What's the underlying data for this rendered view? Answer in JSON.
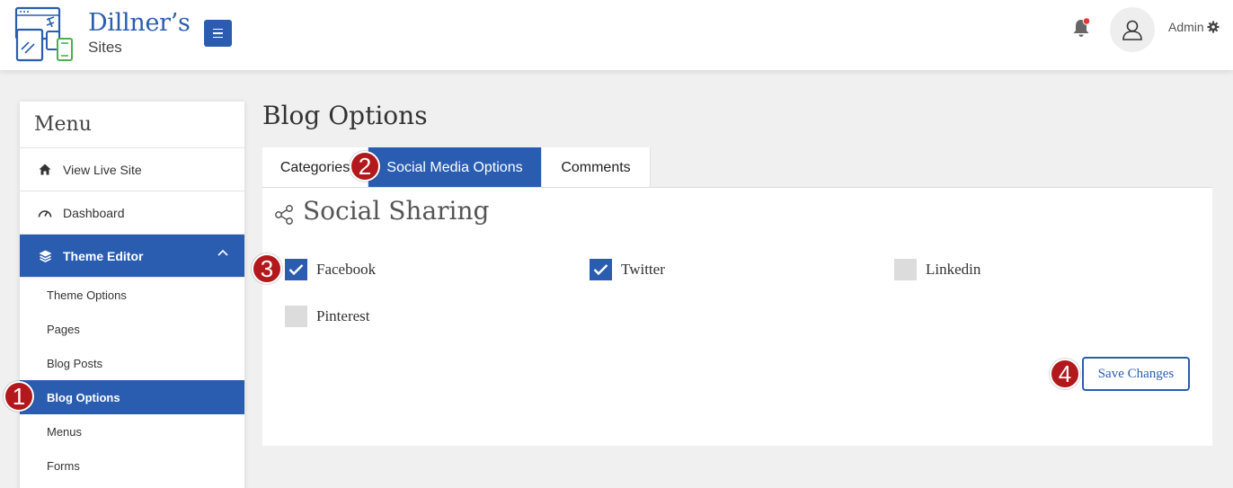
{
  "header": {
    "logo_title": "Dillner’s",
    "logo_subtitle": "Sites",
    "user_label": "Admin"
  },
  "sidebar": {
    "title": "Menu",
    "items": [
      {
        "label": "View Live Site",
        "icon": "home-icon"
      },
      {
        "label": "Dashboard",
        "icon": "dashboard-icon"
      },
      {
        "label": "Theme Editor",
        "icon": "layers-icon",
        "expanded": true
      }
    ],
    "subitems": [
      {
        "label": "Theme Options"
      },
      {
        "label": "Pages"
      },
      {
        "label": "Blog Posts"
      },
      {
        "label": "Blog Options",
        "active": true
      },
      {
        "label": "Menus"
      },
      {
        "label": "Forms"
      }
    ]
  },
  "main": {
    "page_title": "Blog Options",
    "tabs": [
      {
        "label": "Categories"
      },
      {
        "label": "Social Media Options",
        "active": true
      },
      {
        "label": "Comments"
      }
    ],
    "section_title": "Social Sharing",
    "options": [
      {
        "label": "Facebook",
        "checked": true
      },
      {
        "label": "Twitter",
        "checked": true
      },
      {
        "label": "Linkedin",
        "checked": false
      },
      {
        "label": "Pinterest",
        "checked": false
      }
    ],
    "save_label": "Save Changes"
  },
  "callouts": [
    "1",
    "2",
    "3",
    "4"
  ],
  "colors": {
    "accent": "#2a5db0",
    "callout": "#b3191c",
    "notification_dot": "#e53935"
  }
}
